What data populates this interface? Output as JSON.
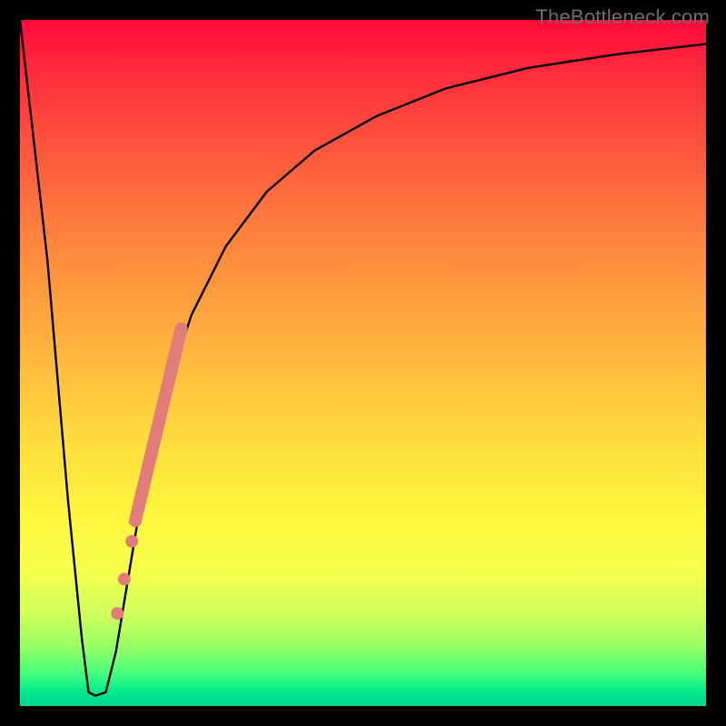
{
  "watermark": "TheBottleneck.com",
  "chart_data": {
    "type": "line",
    "title": "",
    "xlabel": "",
    "ylabel": "",
    "xlim": [
      0,
      100
    ],
    "ylim": [
      0,
      100
    ],
    "black_curve": {
      "x": [
        0,
        4,
        7,
        9,
        10,
        11,
        12.5,
        14,
        16,
        18,
        21,
        25,
        30,
        36,
        43,
        52,
        62,
        74,
        87,
        100
      ],
      "y": [
        100,
        65,
        30,
        10,
        2,
        1.5,
        2,
        8,
        20,
        32,
        45,
        57,
        67,
        75,
        81,
        86,
        90,
        93,
        95,
        96.5
      ]
    },
    "overlay_segment": {
      "color": "#e17c7b",
      "type": "thick_line",
      "x": [
        16.8,
        23.5
      ],
      "y": [
        27,
        55
      ]
    },
    "overlay_dots": {
      "color": "#e17c7b",
      "points": [
        {
          "x": 16.3,
          "y": 24
        },
        {
          "x": 15.2,
          "y": 18.5
        },
        {
          "x": 14.2,
          "y": 13.5
        }
      ]
    }
  }
}
